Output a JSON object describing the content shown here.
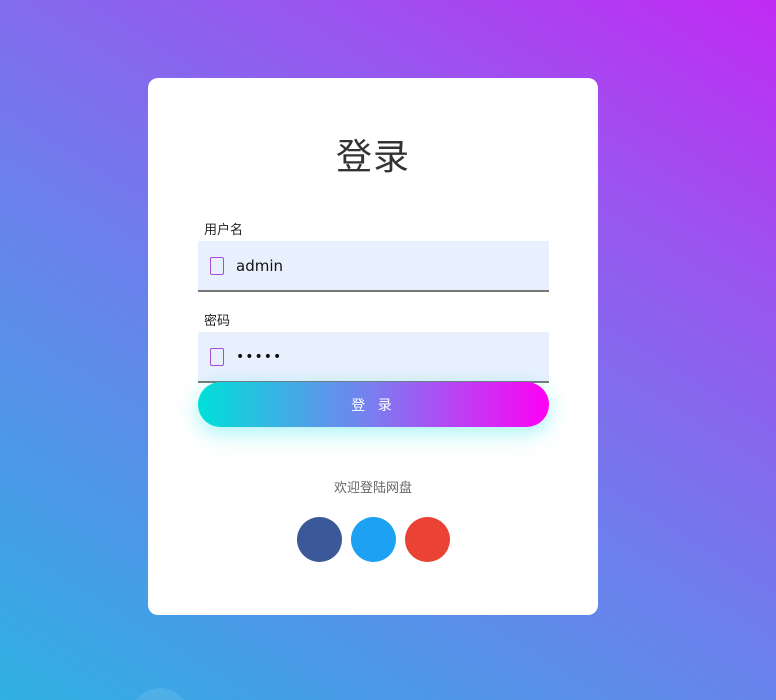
{
  "login": {
    "title": "登录",
    "username_label": "用户名",
    "username_value": "admin",
    "password_label": "密码",
    "password_value": "•••••",
    "submit_label": "登 录",
    "welcome_text": "欢迎登陆网盘"
  },
  "icons": {
    "username": "user-icon",
    "password": "lock-icon"
  },
  "social": [
    {
      "name": "facebook",
      "color": "#3b5998"
    },
    {
      "name": "twitter",
      "color": "#1da1f2"
    },
    {
      "name": "google",
      "color": "#ea4335"
    }
  ],
  "colors": {
    "icon_accent": "#a64bdc",
    "field_bg": "#e8f0fe"
  }
}
